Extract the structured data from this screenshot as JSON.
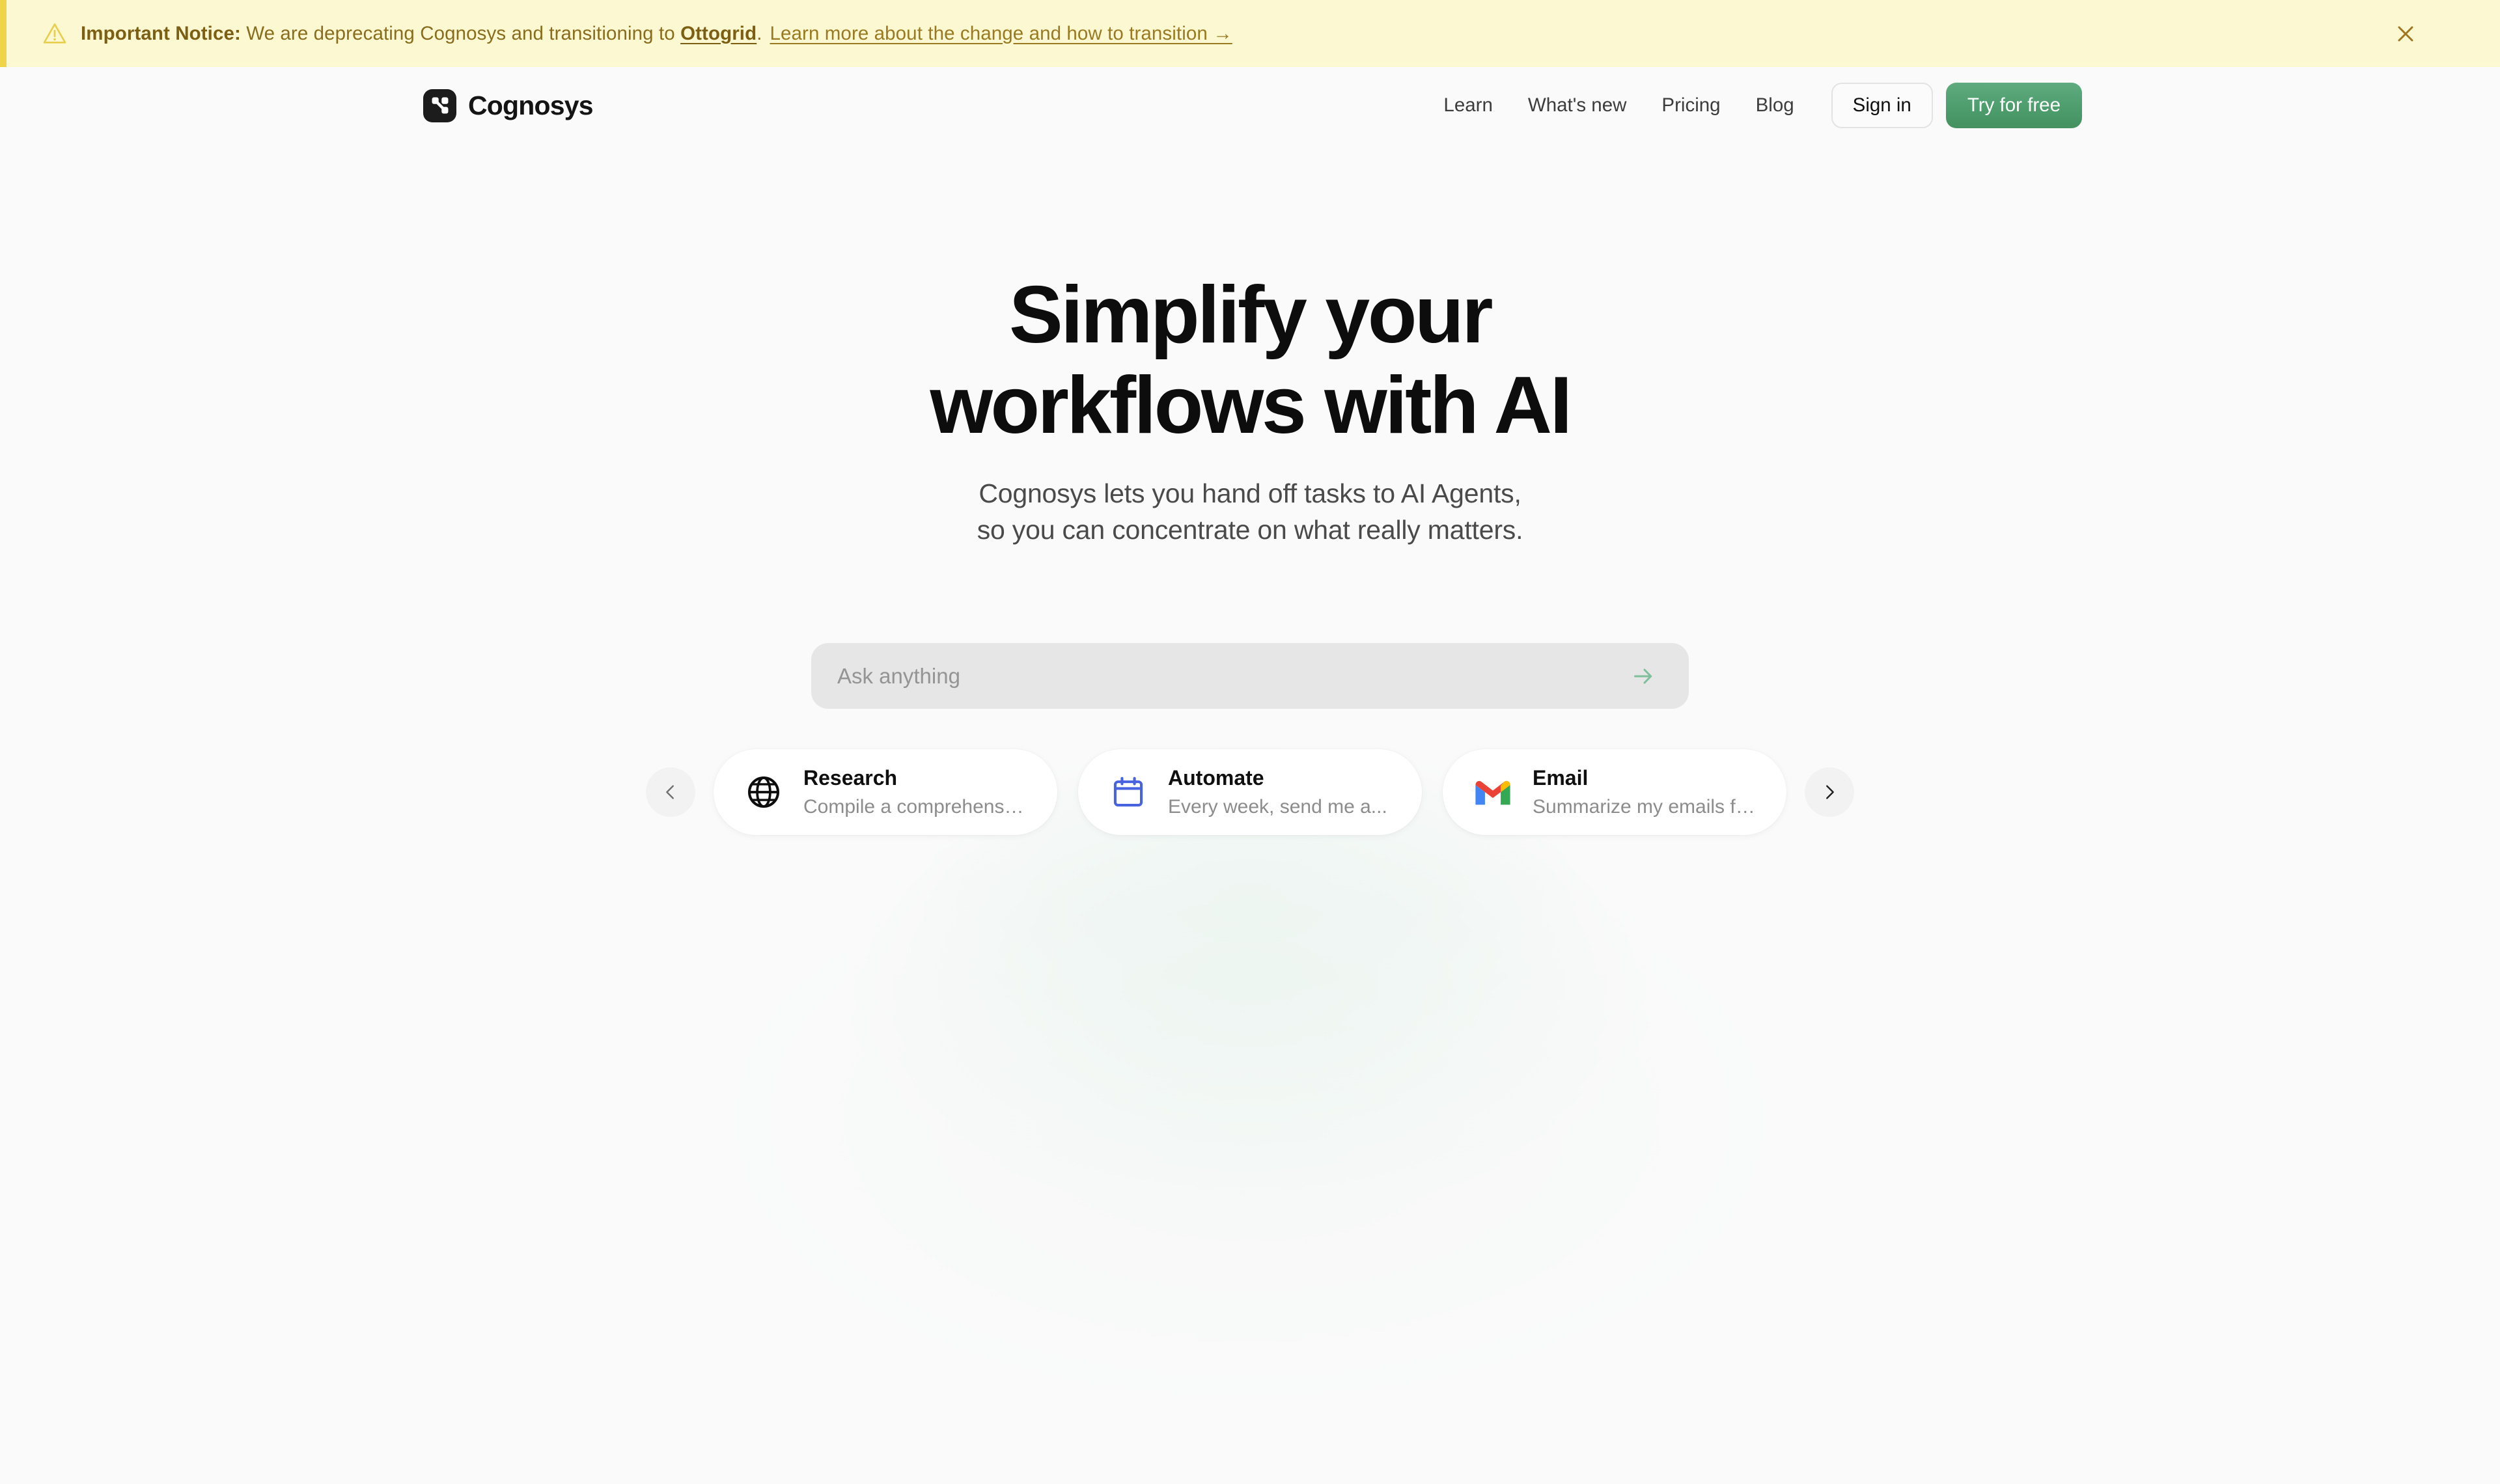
{
  "banner": {
    "icon": "warning-triangle-icon",
    "prefix_bold": "Important Notice:",
    "message": " We are deprecating Cognosys and transitioning to ",
    "brand_link": "Ottogrid",
    "period": ".",
    "more_link": "Learn more about the change and how to transition →",
    "close_icon": "close-icon",
    "bg_color": "#fcf8d2",
    "accent_color": "#efd44a",
    "text_color": "#8a6d1c"
  },
  "header": {
    "logo_text": "Cognosys",
    "logo_icon": "cognosys-logo-icon",
    "nav": [
      {
        "label": "Learn"
      },
      {
        "label": "What's new"
      },
      {
        "label": "Pricing"
      },
      {
        "label": "Blog"
      }
    ],
    "sign_in_label": "Sign in",
    "try_free_label": "Try for free",
    "try_free_color": "#4d9d6d"
  },
  "hero": {
    "title_line1": "Simplify your",
    "title_line2": "workflows with AI",
    "sub_line1": "Cognosys lets you hand off tasks to AI Agents,",
    "sub_line2": "so you can concentrate on what really matters."
  },
  "search": {
    "placeholder": "Ask anything",
    "value": "",
    "send_icon": "arrow-right-icon",
    "send_color": "#7fbf9b"
  },
  "carousel": {
    "prev_icon": "chevron-left-icon",
    "next_icon": "chevron-right-icon",
    "cards": [
      {
        "icon": "globe-icon",
        "title": "Research",
        "desc": "Compile a comprehensive..."
      },
      {
        "icon": "calendar-icon",
        "title": "Automate",
        "desc": "Every week, send me a..."
      },
      {
        "icon": "gmail-icon",
        "title": "Email",
        "desc": "Summarize my emails from..."
      }
    ]
  }
}
